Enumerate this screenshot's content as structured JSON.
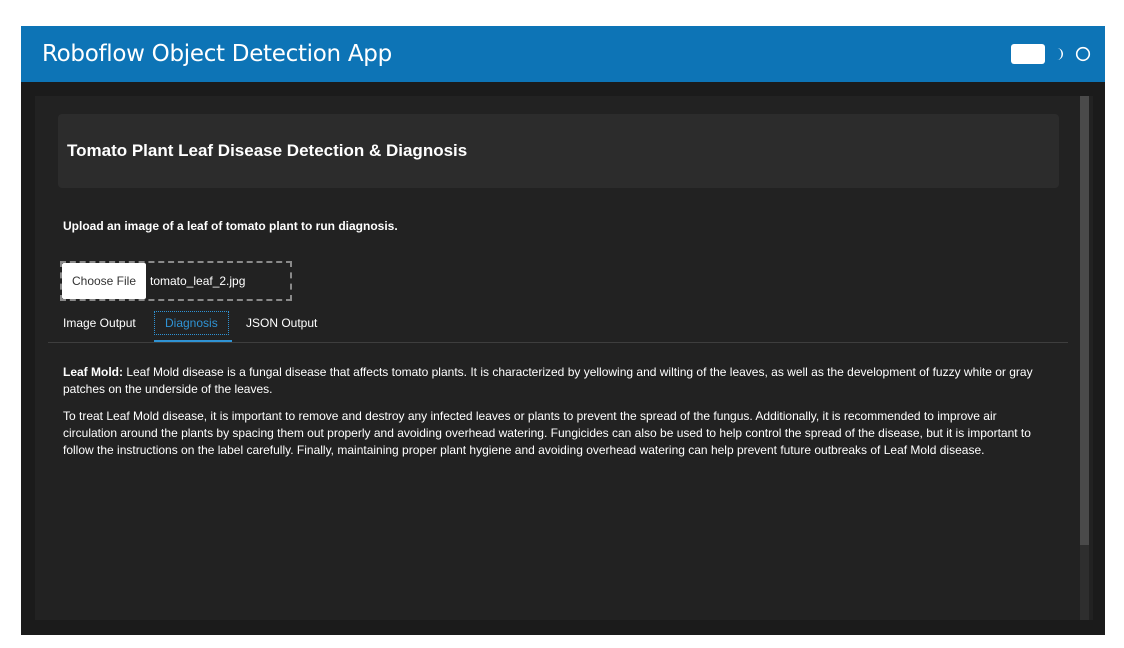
{
  "app": {
    "title": "Roboflow Object Detection App"
  },
  "header_controls": {
    "toggle_icon": "toggle-switch",
    "dark_mode_icon": "moon-icon",
    "light_mode_icon": "sun-icon"
  },
  "main": {
    "heading": "Tomato Plant Leaf Disease Detection & Diagnosis",
    "upload_instruction": "Upload an image of a leaf of tomato plant to run diagnosis.",
    "file_input": {
      "button_label": "Choose File",
      "file_name": "tomato_leaf_2.jpg"
    },
    "tabs": [
      {
        "label": "Image Output",
        "active": false
      },
      {
        "label": "Diagnosis",
        "active": true
      },
      {
        "label": "JSON Output",
        "active": false
      }
    ],
    "diagnosis": {
      "disease_label": "Leaf Mold:",
      "description": " Leaf Mold disease is a fungal disease that affects tomato plants. It is characterized by yellowing and wilting of the leaves, as well as the development of fuzzy white or gray patches on the underside of the leaves.",
      "treatment": "To treat Leaf Mold disease, it is important to remove and destroy any infected leaves or plants to prevent the spread of the fungus. Additionally, it is recommended to improve air circulation around the plants by spacing them out properly and avoiding overhead watering. Fungicides can also be used to help control the spread of the disease, but it is important to follow the instructions on the label carefully. Finally, maintaining proper plant hygiene and avoiding overhead watering can help prevent future outbreaks of Leaf Mold disease."
    }
  },
  "colors": {
    "header_bg": "#0d74b6",
    "page_bg": "#1b1b1b",
    "accent": "#2f93d4"
  }
}
